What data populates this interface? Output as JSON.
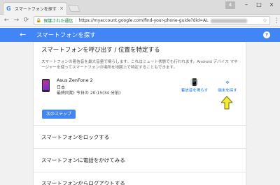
{
  "browser": {
    "tab_favicon": "G",
    "tab_title": "スマートフォンを探す",
    "tab_close": "×",
    "window_badge": "4",
    "window_buttons": [
      "–",
      "□",
      "×"
    ],
    "nav": {
      "back": "←",
      "forward": "→",
      "reload": "⟳"
    },
    "omnibox": {
      "lock_icon": "🔒",
      "secure_label": "保護された通信",
      "separator": "|",
      "url": "https://myaccount.google.com/find-your-phone-guide?did=AL"
    },
    "star_icon": "☆",
    "menu_icon": "⋮"
  },
  "app": {
    "back_icon": "←",
    "title": "スマートフォンを探す",
    "help_icon": "?",
    "accent": "#4285f4"
  },
  "section": {
    "title": "スマートフォンを呼び出す / 位置を特定する",
    "description": "スマートフォンの着信音を最大音量で鳴らします。これはミュート状態でも行われます。Android デバイス マネージャーを使ってスマートフォンの場所を地図上で特定することもできます。"
  },
  "device": {
    "name": "Asus ZenFone 2",
    "country": "日本",
    "last_sync": "最終同期: 今日の 20:15(34 分前)"
  },
  "actions": {
    "ring": {
      "icon": "ring-phone-icon",
      "glyph": "📳",
      "label": "着信音を鳴らす"
    },
    "find": {
      "icon": "find-device-icon",
      "glyph": "⌖",
      "label": "端末を探す"
    }
  },
  "next_button": "次のステップ",
  "menu_items": [
    {
      "label": "スマートフォンをロックする"
    },
    {
      "label": "スマートフォンに電話をかけてみる"
    },
    {
      "label": "スマートフォンからログアウトする"
    }
  ]
}
